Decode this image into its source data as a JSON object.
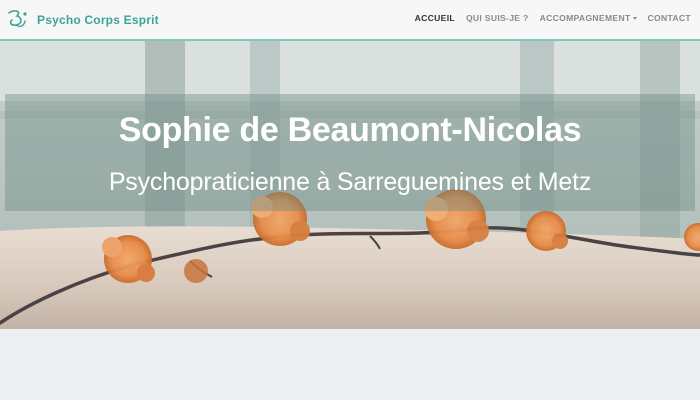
{
  "header": {
    "brand_name": "Psycho Corps Esprit",
    "brand_icon": "swirl-logo-icon",
    "accent_color": "#3aa597"
  },
  "nav": {
    "items": [
      {
        "label": "ACCUEIL",
        "active": true
      },
      {
        "label": "QUI SUIS-JE ?",
        "active": false
      },
      {
        "label": "ACCOMPAGNEMENT",
        "active": false,
        "dropdown": true
      },
      {
        "label": "CONTACT",
        "active": false
      }
    ]
  },
  "hero": {
    "title": "Sophie de Beaumont-Nicolas",
    "subtitle": "Psychopraticienne à Sarreguemines et Metz",
    "image": "dried-orange-flowers-on-branch"
  }
}
